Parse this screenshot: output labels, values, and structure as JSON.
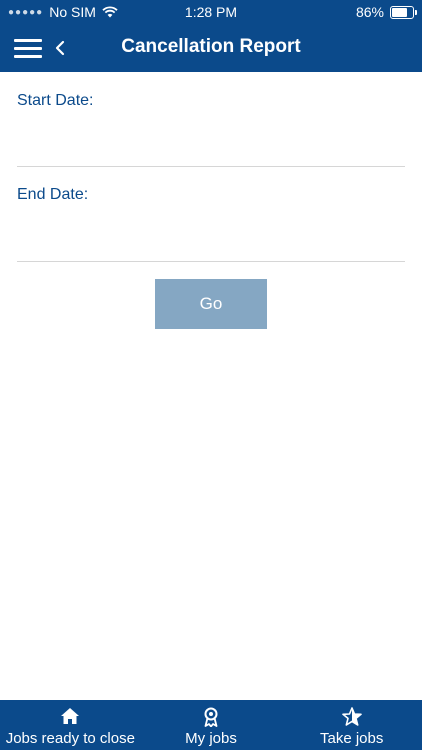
{
  "status_bar": {
    "carrier": "No SIM",
    "time": "1:28 PM",
    "battery_percent_text": "86%",
    "battery_level": 0.86
  },
  "nav": {
    "title": "Cancellation Report",
    "menu_icon": "hamburger-menu-icon",
    "back_icon": "chevron-left-icon"
  },
  "form": {
    "start_date_label": "Start Date:",
    "start_date_value": "",
    "end_date_label": "End Date:",
    "end_date_value": "",
    "go_label": "Go"
  },
  "tabs": [
    {
      "label": "Jobs ready to close",
      "icon": "home-icon"
    },
    {
      "label": "My jobs",
      "icon": "award-ribbon-icon"
    },
    {
      "label": "Take jobs",
      "icon": "star-icon"
    }
  ],
  "colors": {
    "primary": "#0b4a8b",
    "button_disabled": "#85a7c3",
    "divider": "#d6d6d6"
  }
}
